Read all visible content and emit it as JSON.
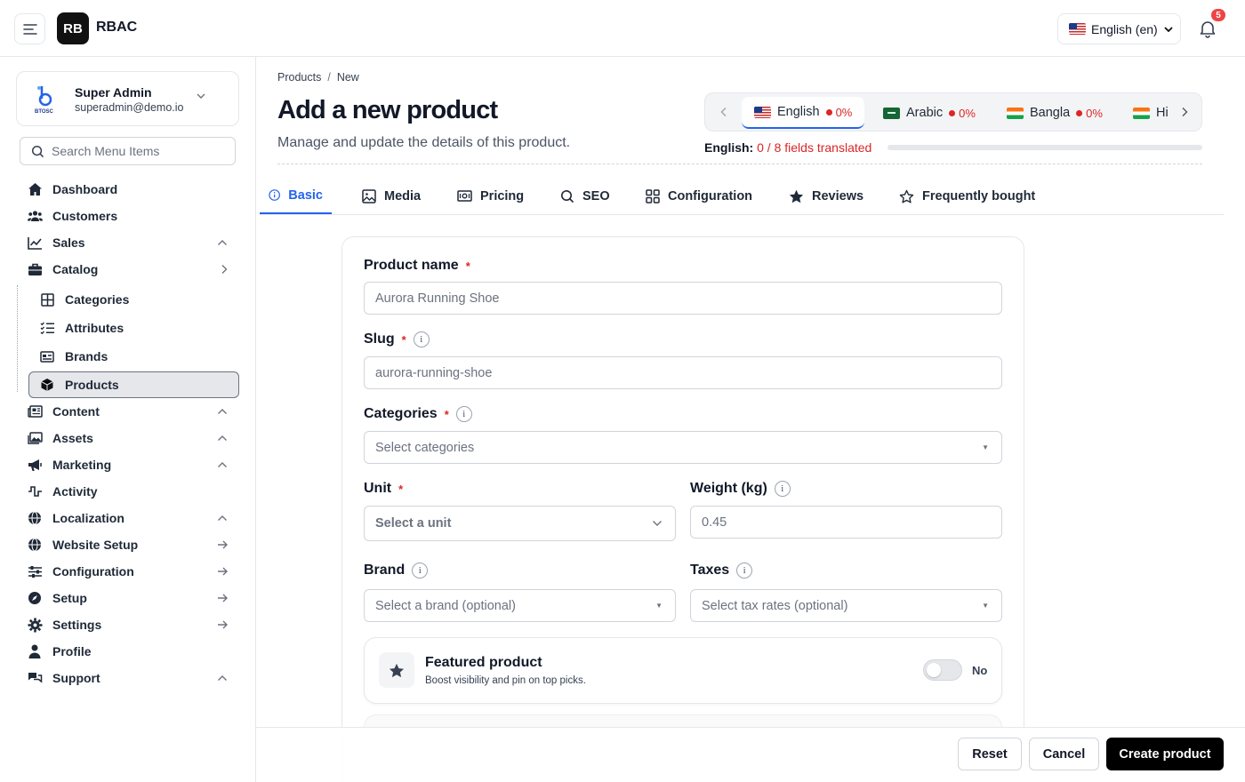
{
  "header": {
    "logo_text": "RB",
    "app_name": "RBAC",
    "language_select": "English (en)",
    "notification_count": "5"
  },
  "user": {
    "name": "Super Admin",
    "email": "superadmin@demo.io",
    "logo_text": "BTOSC"
  },
  "sidebar": {
    "search_placeholder": "Search Menu Items",
    "items": [
      {
        "label": "Dashboard",
        "icon": "home-icon"
      },
      {
        "label": "Customers",
        "icon": "users-icon"
      },
      {
        "label": "Sales",
        "icon": "chart-line-icon"
      },
      {
        "label": "Catalog",
        "icon": "briefcase-icon"
      },
      {
        "label": "Content",
        "icon": "newspaper-icon"
      },
      {
        "label": "Assets",
        "icon": "images-icon"
      },
      {
        "label": "Marketing",
        "icon": "megaphone-icon"
      },
      {
        "label": "Activity",
        "icon": "pulse-icon"
      },
      {
        "label": "Localization",
        "icon": "globe-icon"
      },
      {
        "label": "Website Setup",
        "icon": "globe-icon"
      },
      {
        "label": "Configuration",
        "icon": "sliders-icon"
      },
      {
        "label": "Setup",
        "icon": "compass-icon"
      },
      {
        "label": "Settings",
        "icon": "gear-icon"
      },
      {
        "label": "Profile",
        "icon": "user-icon"
      },
      {
        "label": "Support",
        "icon": "chat-icon"
      }
    ],
    "catalog_sub": [
      {
        "label": "Categories",
        "icon": "grid-icon"
      },
      {
        "label": "Attributes",
        "icon": "checklist-icon"
      },
      {
        "label": "Brands",
        "icon": "card-icon"
      },
      {
        "label": "Products",
        "icon": "box-icon"
      }
    ]
  },
  "breadcrumb": {
    "parent": "Products",
    "separator": "/",
    "current": "New"
  },
  "page": {
    "title": "Add a new product",
    "subtitle": "Manage and update the details of this product."
  },
  "languages": [
    {
      "name": "English",
      "pct": "0%"
    },
    {
      "name": "Arabic",
      "pct": "0%"
    },
    {
      "name": "Bangla",
      "pct": "0%"
    },
    {
      "name": "Hi"
    }
  ],
  "translation": {
    "label": "English:",
    "count": "0 / 8 fields translated",
    "progress": 0
  },
  "tabs": [
    "Basic",
    "Media",
    "Pricing",
    "SEO",
    "Configuration",
    "Reviews",
    "Frequently bought"
  ],
  "form": {
    "product_name": {
      "label": "Product name",
      "required": "*",
      "placeholder": "Aurora Running Shoe"
    },
    "slug": {
      "label": "Slug",
      "required": "*",
      "info": "i",
      "placeholder": "aurora-running-shoe"
    },
    "categories": {
      "label": "Categories",
      "required": "*",
      "info": "i",
      "placeholder": "Select categories"
    },
    "unit": {
      "label": "Unit",
      "required": "*",
      "placeholder": "Select a unit"
    },
    "weight": {
      "label": "Weight (kg)",
      "info": "i",
      "placeholder": "0.45"
    },
    "brand": {
      "label": "Brand",
      "info": "i",
      "placeholder": "Select a brand (optional)"
    },
    "taxes": {
      "label": "Taxes",
      "info": "i",
      "placeholder": "Select tax rates (optional)"
    },
    "featured": {
      "title": "Featured product",
      "description": "Boost visibility and pin on top picks.",
      "toggle_label": "No",
      "enabled": false
    }
  },
  "footer": {
    "reset": "Reset",
    "cancel": "Cancel",
    "create": "Create product"
  },
  "colors": {
    "accent": "#2563eb",
    "danger": "#dc2626",
    "primary_button": "#000000"
  }
}
